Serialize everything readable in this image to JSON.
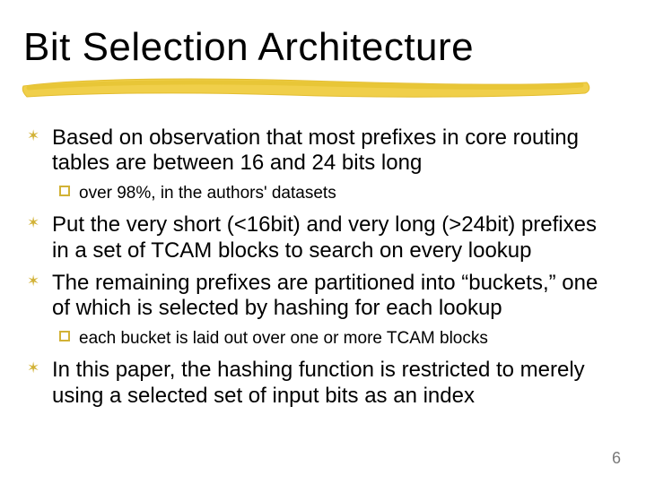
{
  "title": "Bit Selection Architecture",
  "bullets": {
    "b0": "Based on observation that most prefixes in core routing tables are between 16 and 24 bits long",
    "b0s0": "over 98%, in the authors' datasets",
    "b1": "Put the very short (<16bit) and very long (>24bit) prefixes in a set of TCAM blocks to search on every lookup",
    "b2": "The remaining prefixes are partitioned into “buckets,” one of which is selected by hashing for each lookup",
    "b2s0": "each bucket is laid out over one or more TCAM blocks",
    "b3": "In this paper, the hashing function is restricted to merely using a selected set of input bits as an index"
  },
  "page_number": "6",
  "icons": {
    "z_bullet": "✶"
  }
}
